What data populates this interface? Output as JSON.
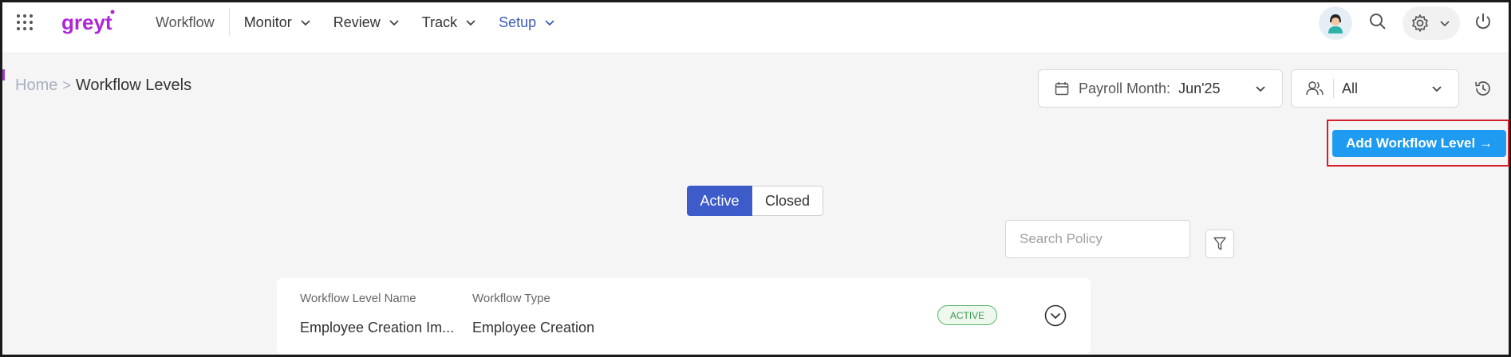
{
  "header": {
    "logo_text": "greyt",
    "nav": [
      {
        "label": "Workflow"
      },
      {
        "label": "Monitor"
      },
      {
        "label": "Review"
      },
      {
        "label": "Track"
      },
      {
        "label": "Setup"
      }
    ],
    "icons": [
      "apps-grid-icon",
      "avatar",
      "search-icon",
      "gear-icon",
      "power-icon"
    ]
  },
  "breadcrumb": {
    "home": "Home",
    "separator": ">",
    "current": "Workflow Levels"
  },
  "filters": {
    "payroll_label": "Payroll Month:",
    "payroll_value": "Jun'25",
    "group_value": "All"
  },
  "actions": {
    "add_label": "Add Workflow Level →"
  },
  "tabs": {
    "active": "Active",
    "closed": "Closed"
  },
  "search": {
    "placeholder": "Search Policy"
  },
  "list": {
    "columns": [
      "Workflow Level Name",
      "Workflow Type"
    ],
    "rows": [
      {
        "name": "Employee Creation Im...",
        "type": "Employee Creation",
        "status": "ACTIVE"
      }
    ]
  },
  "colors": {
    "accent": "#1e9bf0",
    "tab_active": "#3d5bc9",
    "setup_nav": "#3b5bb7",
    "logo": "#b026d4",
    "status_green": "#3d9b4f",
    "highlight": "#d0202a"
  }
}
